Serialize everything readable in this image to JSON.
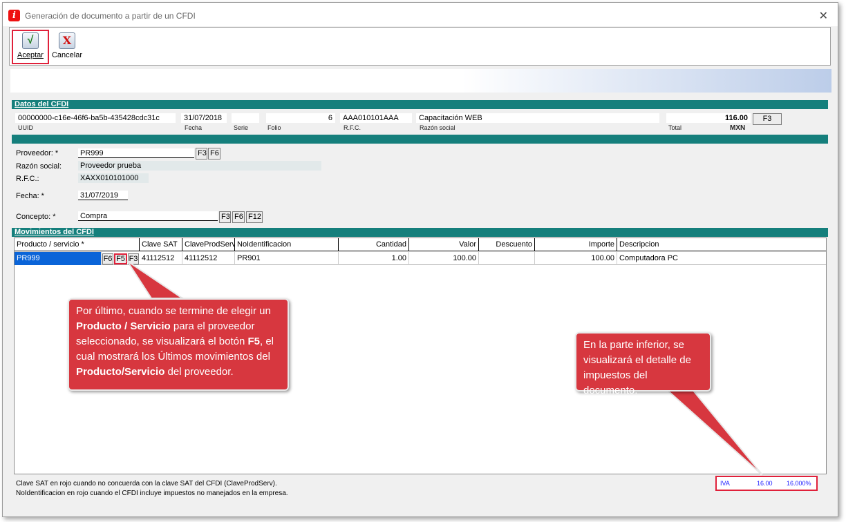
{
  "window": {
    "title": "Generación de documento a partir de un CFDI",
    "close_glyph": "✕"
  },
  "toolbar": {
    "accept_label": "Aceptar",
    "cancel_label": "Cancelar"
  },
  "datos_cfdi": {
    "section_title": "Datos del CFDI",
    "uuid": "00000000-c16e-46f6-ba5b-435428cdc31c",
    "fecha": "31/07/2018",
    "serie": "",
    "folio": "6",
    "rfc": "AAA010101AAA",
    "razon_social": "Capacitación WEB",
    "total": "116.00",
    "moneda": "MXN",
    "f3_label": "F3",
    "labels": {
      "uuid": "UUID",
      "fecha": "Fecha",
      "serie": "Serie",
      "folio": "Folio",
      "rfc": "R.F.C.",
      "razon_social": "Razón social",
      "total": "Total"
    }
  },
  "form": {
    "proveedor_label": "Proveedor: *",
    "proveedor_value": "PR999",
    "razon_social_label": "Razón social:",
    "razon_social_value": "Proveedor prueba",
    "rfc_label": "R.F.C.:",
    "rfc_value": "XAXX010101000",
    "fecha_label": "Fecha: *",
    "fecha_value": "31/07/2019",
    "concepto_label": "Concepto: *",
    "concepto_value": "Compra",
    "btn_f3": "F3",
    "btn_f6": "F6",
    "btn_f12": "F12"
  },
  "movimientos": {
    "section_title": "Movimientos del CFDI",
    "columns": [
      "Producto / servicio *",
      "Clave SAT",
      "ClaveProdServ",
      "NoIdentificacion",
      "Cantidad",
      "Valor",
      "Descuento",
      "Importe",
      "Descripcion"
    ],
    "rows": [
      {
        "producto": "PR999",
        "clave_sat": "41112512",
        "clave_prod_serv": "41112512",
        "no_identificacion": "PR901",
        "cantidad": "1.00",
        "valor": "100.00",
        "descuento": "",
        "importe": "100.00",
        "descripcion": "Computadora PC"
      }
    ],
    "row_buttons": [
      "F6",
      "F5",
      "F3"
    ]
  },
  "callouts": {
    "left": {
      "t1": "Por último, cuando se termine de elegir un ",
      "b1": "Producto / Servicio",
      "t2": " para el proveedor seleccionado, se visualizará el botón ",
      "b2": "F5",
      "t3": ", el cual mostrará los Últimos movimientos del ",
      "b3": "Producto/Servicio",
      "t4": " del proveedor."
    },
    "right": "En la parte inferior, se visualizará el detalle de impuestos del documento."
  },
  "notes": {
    "line1": "Clave SAT en rojo cuando no concuerda con la clave SAT del CFDI (ClaveProdServ).",
    "line2": "NoIdentificacion en rojo cuando el CFDI incluye impuestos no manejados en la empresa."
  },
  "taxes": {
    "name": "IVA",
    "amount": "16.00",
    "rate": "16.000%"
  },
  "colors": {
    "section_teal": "#157f7c",
    "highlight_red": "#e0203a",
    "callout_red": "#d7373f",
    "selection_blue": "#0a64d8",
    "tax_blue": "#1a1aff"
  }
}
